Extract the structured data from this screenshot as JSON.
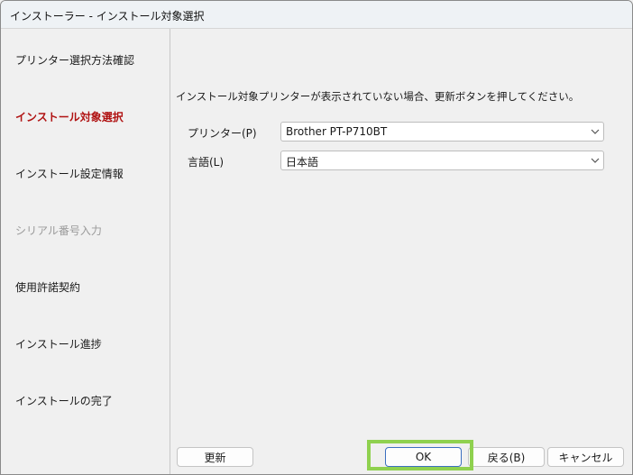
{
  "window": {
    "title": "インストーラー - インストール対象選択"
  },
  "sidebar": {
    "items": [
      {
        "label": "プリンター選択方法確認",
        "state": "normal"
      },
      {
        "label": "インストール対象選択",
        "state": "active"
      },
      {
        "label": "インストール設定情報",
        "state": "normal"
      },
      {
        "label": "シリアル番号入力",
        "state": "disabled"
      },
      {
        "label": "使用許諾契約",
        "state": "normal"
      },
      {
        "label": "インストール進捗",
        "state": "normal"
      },
      {
        "label": "インストールの完了",
        "state": "normal"
      }
    ]
  },
  "main": {
    "instruction": "インストール対象プリンターが表示されていない場合、更新ボタンを押してください。",
    "printer": {
      "label": "プリンター(P)",
      "value": "Brother PT-P710BT"
    },
    "language": {
      "label": "言語(L)",
      "value": "日本語"
    }
  },
  "buttons": {
    "refresh": "更新",
    "ok": "OK",
    "back": "戻る(B)",
    "cancel": "キャンセル"
  },
  "colors": {
    "active_step": "#b01212",
    "disabled_step": "#9a9a9a",
    "highlight": "#8fd14f",
    "ok_border": "#3b6fc0"
  },
  "icons": {
    "dropdown": "chevron-down-icon"
  }
}
